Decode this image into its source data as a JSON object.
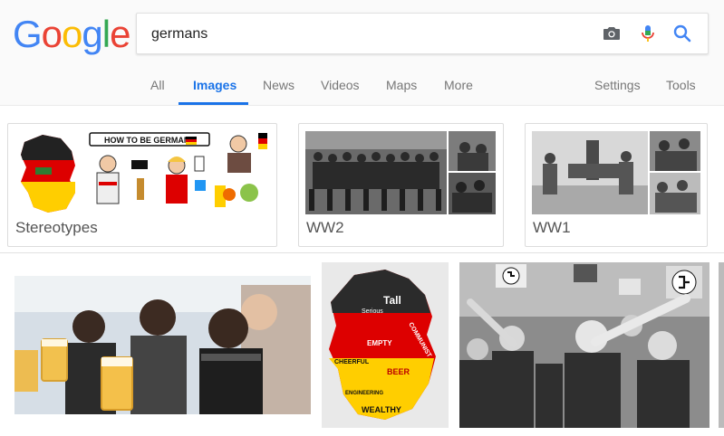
{
  "logo": {
    "letters": [
      "G",
      "o",
      "o",
      "g",
      "l",
      "e"
    ],
    "colors": [
      "#4285f4",
      "#ea4335",
      "#fbbc05",
      "#4285f4",
      "#34a853",
      "#ea4335"
    ]
  },
  "search": {
    "value": "germans"
  },
  "tabs": [
    {
      "label": "All",
      "active": false
    },
    {
      "label": "Images",
      "active": true
    },
    {
      "label": "News",
      "active": false
    },
    {
      "label": "Videos",
      "active": false
    },
    {
      "label": "Maps",
      "active": false
    },
    {
      "label": "More",
      "active": false
    },
    {
      "label": "Settings",
      "active": false
    },
    {
      "label": "Tools",
      "active": false
    }
  ],
  "chips": [
    {
      "label": "Stereotypes",
      "banner": "HOW TO BE GERMAN"
    },
    {
      "label": "WW2"
    },
    {
      "label": "WW1"
    }
  ],
  "results": {
    "map_words": [
      "Tall",
      "Serious",
      "EMPTY",
      "COMMUNIST",
      "CHEERFUL",
      "BEER",
      "ENGINEERING",
      "WEALTHY"
    ]
  },
  "colors": {
    "accent": "#1a73e8",
    "flag_black": "#000000",
    "flag_red": "#dd0000",
    "flag_gold": "#ffce00"
  }
}
